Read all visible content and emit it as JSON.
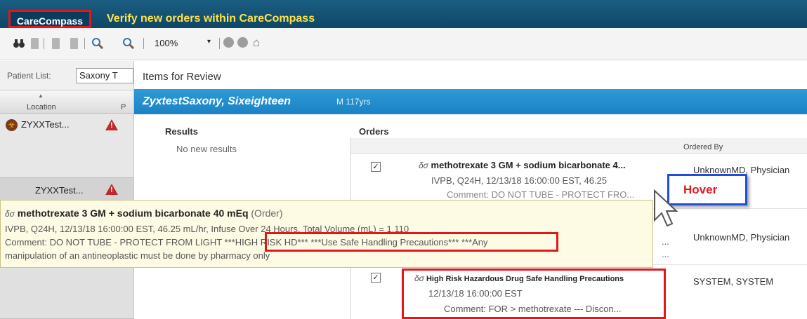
{
  "titlebar": {
    "app_name": "CareCompass",
    "title": "Verify new orders within CareCompass"
  },
  "toolbar": {
    "zoom": "100%",
    "zoom_arrow": "▾",
    "home_icon": "home-icon"
  },
  "patient_list": {
    "label": "Patient List:",
    "selected": "Saxony T",
    "sort_glyph": "▲",
    "col_location": "Location",
    "col_p": "P",
    "rows": [
      {
        "text": "ZYXXTest..."
      },
      {
        "text": "ZYXXTest..."
      }
    ],
    "alert_glyph": "!",
    "alert_suffix": "z",
    "bio_glyph": "☣"
  },
  "dialog": {
    "title": "Items for Review",
    "patient_name": "ZyxtestSaxony, Sixeighteen",
    "patient_demo": "M 117yrs",
    "results_head": "Results",
    "results_empty": "No new results",
    "orders_head": "Orders",
    "ordered_by_head": "Ordered By",
    "check_glyph": "✓",
    "glasses_glyph": "δσ",
    "orders": [
      {
        "title": "methotrexate 3 GM + sodium bicarbonate 4...",
        "detail1": "IVPB, Q24H, 12/13/18 16:00:00 EST, 46.25",
        "detail2": "Comment: DO NOT TUBE - PROTECT FRO...",
        "ordered_by": "UnknownMD, Physician"
      },
      {
        "title": "",
        "detail1": "...",
        "detail2": "...",
        "ordered_by": "UnknownMD, Physician"
      },
      {
        "title": "High Risk Hazardous Drug Safe Handling Precautions",
        "detail1": "12/13/18 16:00:00 EST",
        "detail2": "Comment: FOR > methotrexate --- Discon...",
        "ordered_by": "SYSTEM, SYSTEM"
      }
    ]
  },
  "tooltip": {
    "title": "methotrexate 3 GM + sodium bicarbonate 40 mEq",
    "type": "(Order)",
    "line1": "IVPB, Q24H, 12/13/18 16:00:00 EST, 46.25 mL/hr, Infuse Over 24 Hours, Total Volume (mL) = 1,110",
    "line2": "Comment: DO NOT TUBE - PROTECT FROM LIGHT ***HIGH RISK HD*** ***Use Safe Handling Precautions*** ***Any",
    "line3": "manipulation of an antineoplastic must be done by pharmacy only"
  },
  "hover_callout": {
    "label": "Hover"
  },
  "colors": {
    "title_bg": "#0f4766",
    "title_text": "#ffe24a",
    "highlight_red": "#e0181b",
    "banner_blue": "#1b82c4",
    "callout_blue": "#1f4fd8",
    "tooltip_bg": "#fdfbe4"
  }
}
